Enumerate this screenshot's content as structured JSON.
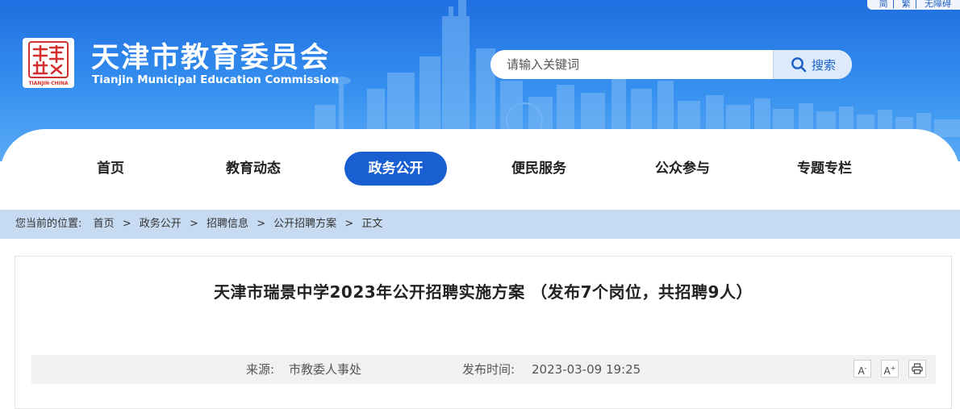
{
  "top_links": [
    "简",
    "繁",
    "无障碍"
  ],
  "site": {
    "title": "天津市教育委员会",
    "subtitle": "Tianjin Municipal Education Commission",
    "logo_alt": "天津 TIANJIN·CHINA"
  },
  "search": {
    "placeholder": "请输入关键词",
    "button_label": "搜索"
  },
  "nav": {
    "items": [
      {
        "label": "首页"
      },
      {
        "label": "教育动态"
      },
      {
        "label": "政务公开",
        "active": true
      },
      {
        "label": "便民服务"
      },
      {
        "label": "公众参与"
      },
      {
        "label": "专题专栏"
      }
    ]
  },
  "breadcrumb": {
    "label": "您当前的位置:",
    "items": [
      "首页",
      "政务公开",
      "招聘信息",
      "公开招聘方案",
      "正文"
    ],
    "separator": ">"
  },
  "article": {
    "title": "天津市瑞景中学2023年公开招聘实施方案 （发布7个岗位，共招聘9人）",
    "source_label": "来源:",
    "source_value": "市教委人事处",
    "time_label": "发布时间:",
    "time_value": "2023-03-09 19:25"
  },
  "tools": {
    "font_smaller": "A-",
    "font_larger": "A+",
    "print_icon": "printer-icon"
  },
  "colors": {
    "header_blue": "#2a7ee8",
    "nav_active": "#1a5fd1",
    "breadcrumb_bg": "#c6dbf2"
  }
}
